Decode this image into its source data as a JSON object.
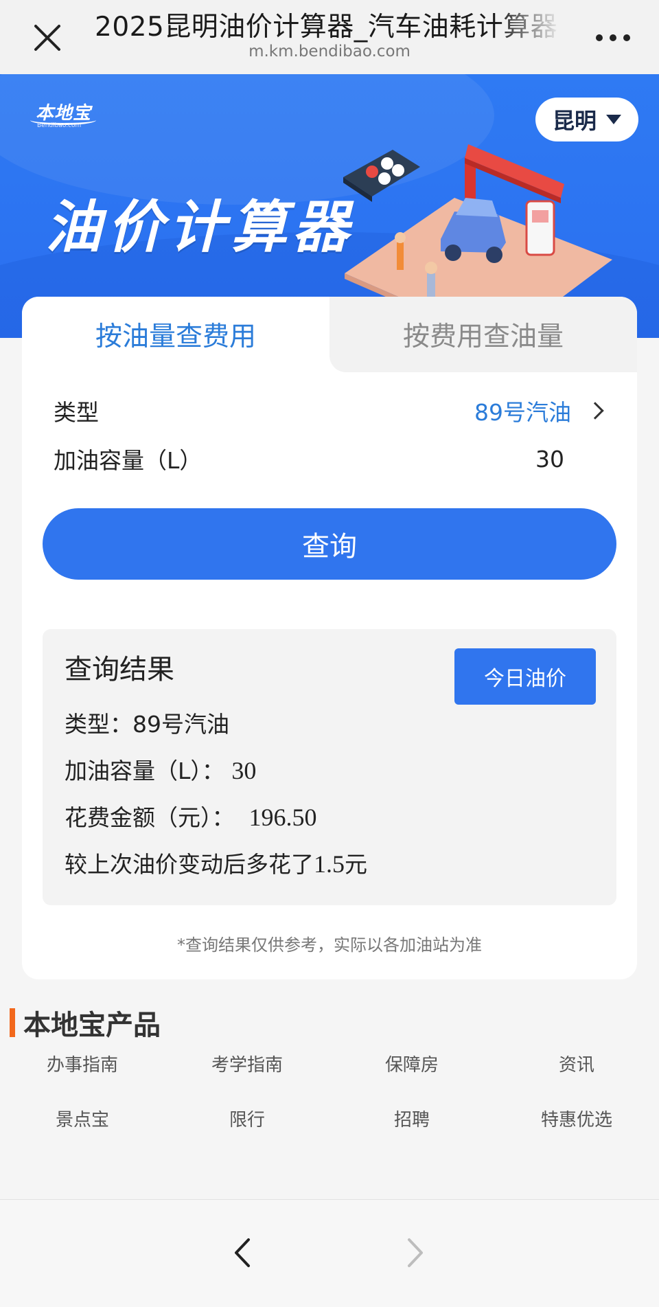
{
  "browser": {
    "title": "2025昆明油价计算器_汽车油耗计算器",
    "url": "m.km.bendibao.com"
  },
  "hero": {
    "logo_cn": "本地宝",
    "logo_en": "Bendibao.com",
    "title": "油价计算器",
    "city": "昆明"
  },
  "tabs": {
    "by_volume": "按油量查费用",
    "by_cost": "按费用查油量"
  },
  "form": {
    "type_label": "类型",
    "type_value": "89号汽油",
    "volume_label": "加油容量（L）",
    "volume_value": "30",
    "query_button": "查询"
  },
  "result": {
    "title": "查询结果",
    "today_price_button": "今日油价",
    "type_label": "类型：",
    "type_value": "89号汽油",
    "volume_label": "加油容量（L）：",
    "volume_value": "30",
    "cost_label": "花费金额（元）：",
    "cost_value": "196.50",
    "change_prefix": "较上次油价变动后多花了",
    "change_value": "1.5",
    "change_suffix": "元"
  },
  "disclaimer": "*查询结果仅供参考，实际以各加油站为准",
  "products": {
    "title": "本地宝产品",
    "items": [
      "办事指南",
      "考学指南",
      "保障房",
      "资讯",
      "景点宝",
      "限行",
      "招聘",
      "特惠优选"
    ]
  },
  "colors": {
    "brand_blue": "#3075ee",
    "tab_active_text": "#2b7cd9",
    "accent_orange": "#f2681c"
  }
}
